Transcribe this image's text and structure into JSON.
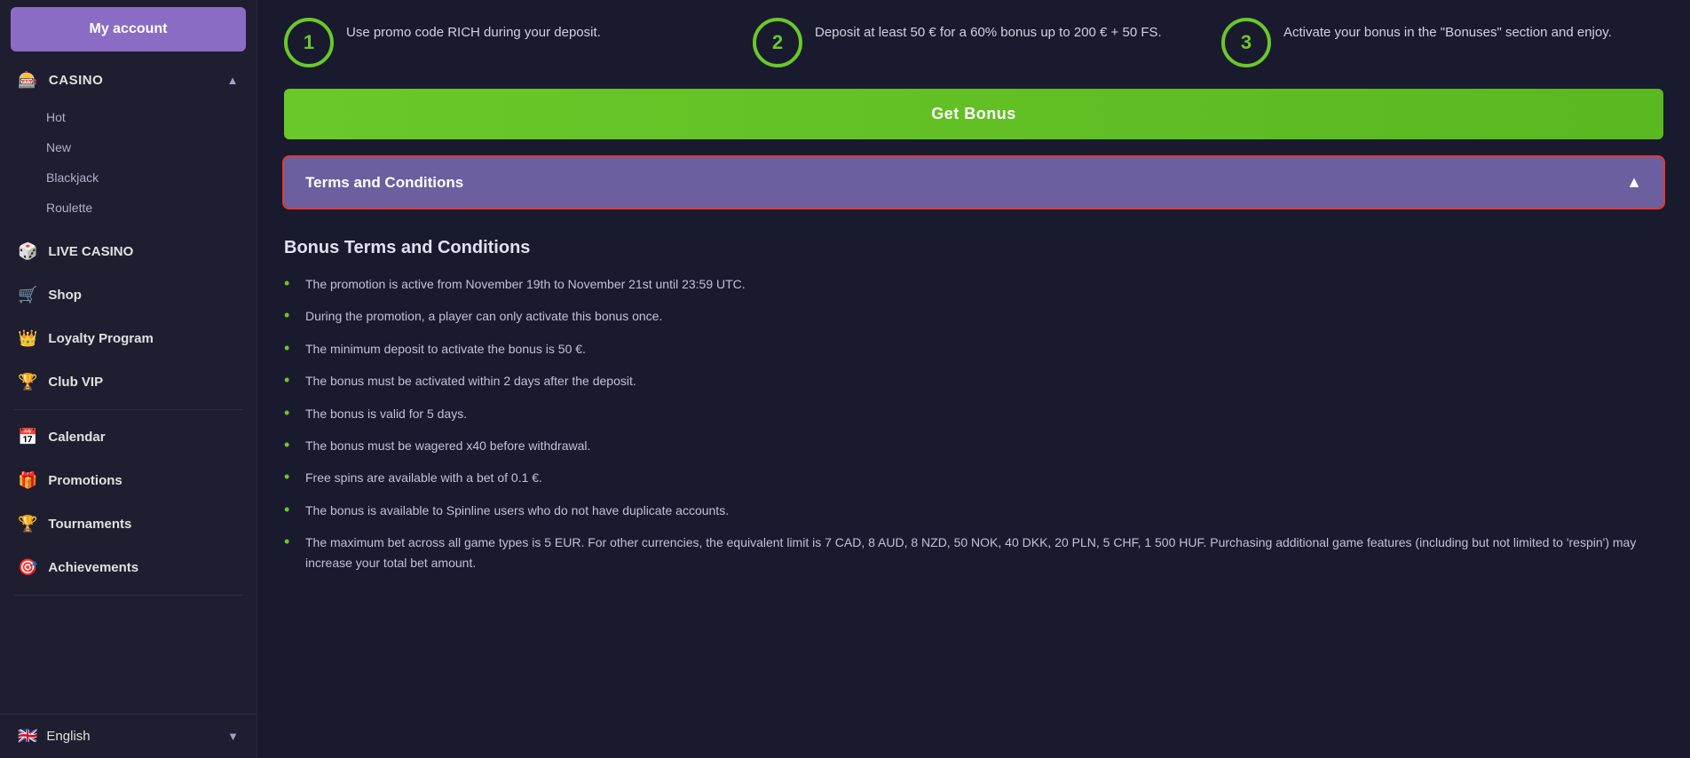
{
  "sidebar": {
    "my_account_label": "My account",
    "casino_label": "CASINO",
    "casino_sub_items": [
      {
        "label": "Hot"
      },
      {
        "label": "New"
      },
      {
        "label": "Blackjack"
      },
      {
        "label": "Roulette"
      }
    ],
    "nav_items": [
      {
        "label": "LIVE CASINO",
        "icon": "🎲"
      },
      {
        "label": "Shop",
        "icon": "🛒"
      },
      {
        "label": "Loyalty Program",
        "icon": "👑"
      },
      {
        "label": "Club VIP",
        "icon": "🏆"
      },
      {
        "label": "Calendar",
        "icon": "📅"
      },
      {
        "label": "Promotions",
        "icon": "🎁"
      },
      {
        "label": "Tournaments",
        "icon": "🏆"
      },
      {
        "label": "Achievements",
        "icon": "🎯"
      }
    ],
    "language": "English"
  },
  "steps": [
    {
      "number": "1",
      "text": "Use promo code RICH during your deposit."
    },
    {
      "number": "2",
      "text": "Deposit at least 50 € for a 60% bonus up to 200 € + 50 FS."
    },
    {
      "number": "3",
      "text": "Activate your bonus in the \"Bonuses\" section and enjoy."
    }
  ],
  "get_bonus_label": "Get Bonus",
  "terms_title": "Terms and Conditions",
  "bonus_terms_heading": "Bonus Terms and Conditions",
  "bonus_terms_items": [
    "The promotion is active from November 19th to November 21st until 23:59 UTC.",
    "During the promotion, a player can only activate this bonus once.",
    "The minimum deposit to activate the bonus is 50 €.",
    "The bonus must be activated within 2 days after the deposit.",
    "The bonus is valid for 5 days.",
    "The bonus must be wagered x40 before withdrawal.",
    "Free spins are available with a bet of 0.1 €.",
    "The bonus is available to Spinline users who do not have duplicate accounts.",
    "The maximum bet across all game types is 5 EUR. For other currencies, the equivalent limit is 7 CAD, 8 AUD, 8 NZD, 50 NOK, 40 DKK, 20 PLN, 5 CHF, 1 500 HUF. Purchasing additional game features (including but not limited to 'respin') may increase your total bet amount."
  ]
}
